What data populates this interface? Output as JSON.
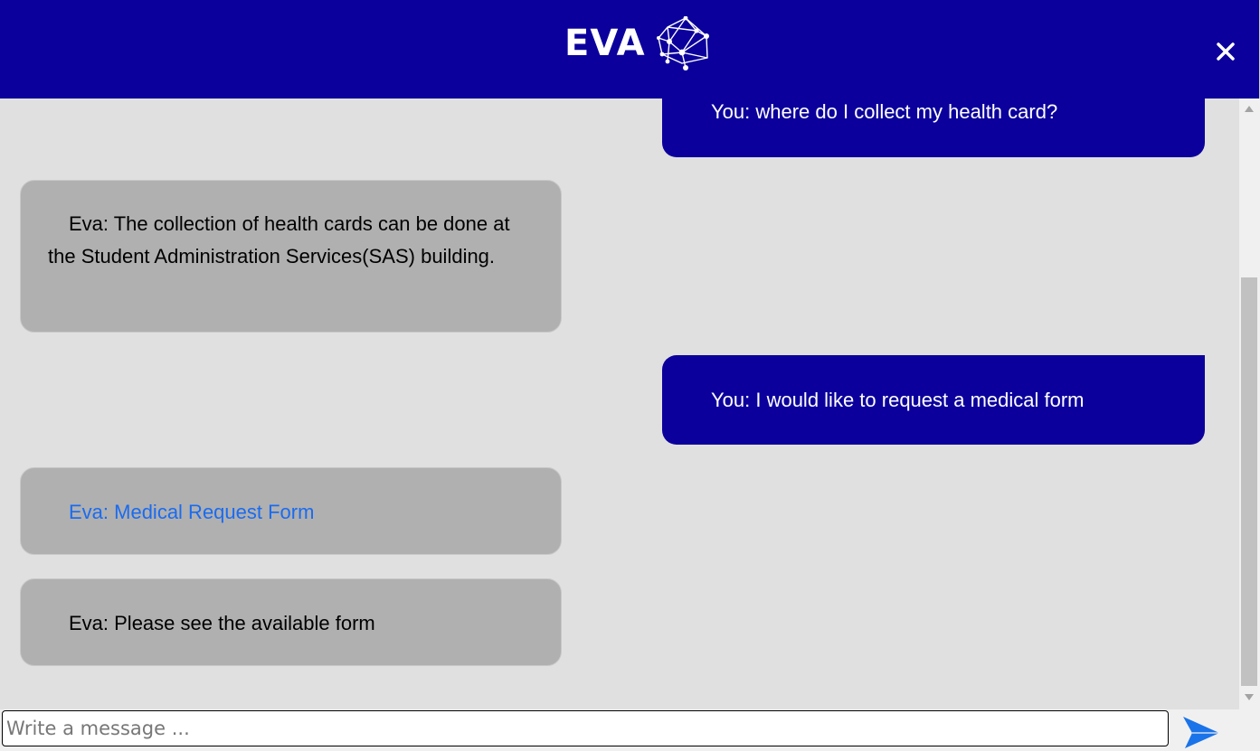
{
  "header": {
    "title": "EVA",
    "logo_icon": "network-globe-icon",
    "close_icon": "close-icon",
    "background": "#0b009c"
  },
  "messages": [
    {
      "sender": "user",
      "text": "You: where do I collect my health card?"
    },
    {
      "sender": "bot",
      "text": "Eva: The collection of health cards can be done at the Student Administration Services(SAS) building."
    },
    {
      "sender": "user",
      "text": "You: I would like to request a medical form"
    },
    {
      "sender": "bot",
      "text": "Eva: Medical Request Form",
      "is_link": true
    },
    {
      "sender": "bot",
      "text": "Eva: Please see the available form"
    }
  ],
  "composer": {
    "placeholder": "Write a message ...",
    "send_icon": "send-icon"
  },
  "colors": {
    "user_bubble": "#0b009c",
    "bot_bubble": "#b0b0b0",
    "link": "#1a6bf0",
    "chat_background": "#e0e0e0"
  }
}
